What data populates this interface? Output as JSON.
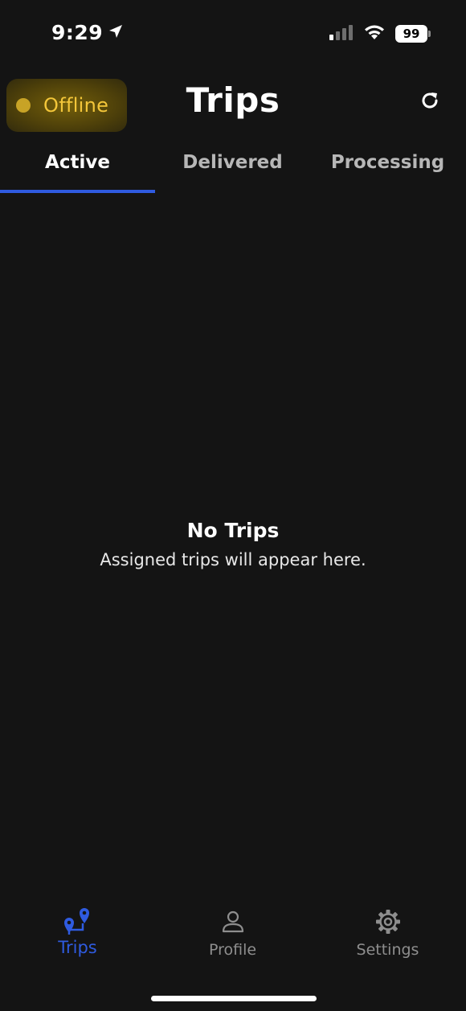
{
  "status_bar": {
    "time": "9:29",
    "battery": "99"
  },
  "header": {
    "status_label": "Offline",
    "title": "Trips"
  },
  "tabs": [
    {
      "label": "Active",
      "active": true
    },
    {
      "label": "Delivered",
      "active": false
    },
    {
      "label": "Processing",
      "active": false
    }
  ],
  "empty_state": {
    "title": "No Trips",
    "subtitle": "Assigned trips will appear here."
  },
  "bottom_nav": [
    {
      "label": "Trips",
      "icon": "map-pin-route-icon",
      "active": true
    },
    {
      "label": "Profile",
      "icon": "person-icon",
      "active": false
    },
    {
      "label": "Settings",
      "icon": "gear-icon",
      "active": false
    }
  ],
  "colors": {
    "background": "#141414",
    "accent": "#2f5be0",
    "offline_text": "#f3c63a",
    "offline_highlight": "#5a4a08",
    "inactive_text": "#8e8e8e"
  }
}
